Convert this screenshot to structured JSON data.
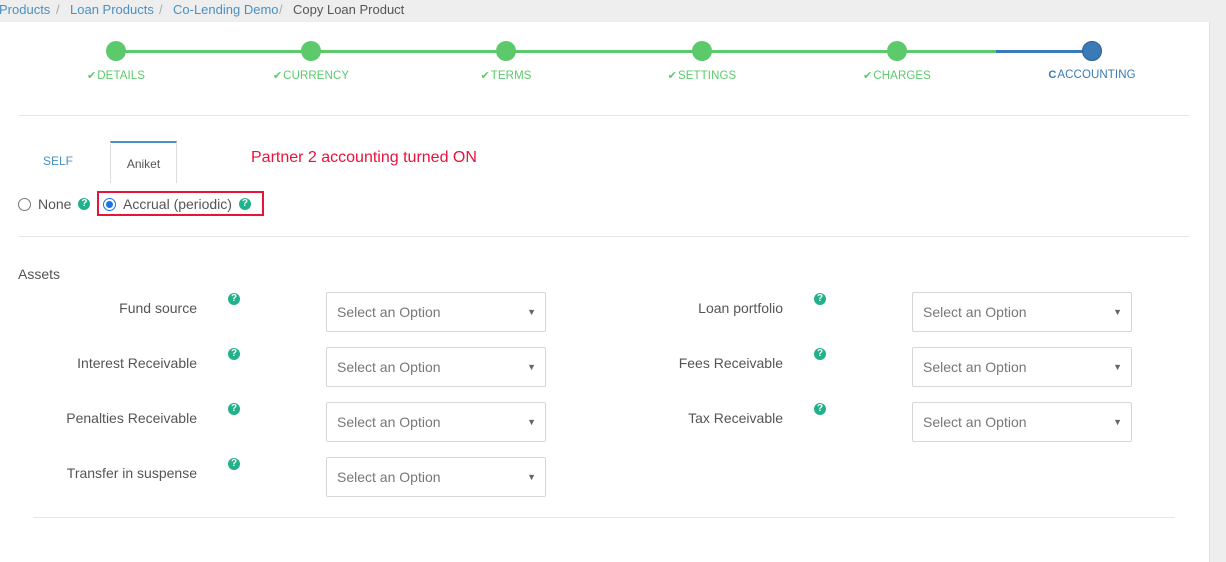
{
  "breadcrumb": {
    "items": [
      "Products",
      "Loan Products",
      "Co-Lending Demo",
      "Copy Loan Product"
    ],
    "separator": "/"
  },
  "stepper": {
    "steps": [
      {
        "label": "DETAILS",
        "icon": "check-icon",
        "status": "done"
      },
      {
        "label": "CURRENCY",
        "icon": "check-icon",
        "status": "done"
      },
      {
        "label": "TERMS",
        "icon": "check-icon",
        "status": "done"
      },
      {
        "label": "SETTINGS",
        "icon": "check-icon",
        "status": "done"
      },
      {
        "label": "CHARGES",
        "icon": "check-icon",
        "status": "done"
      },
      {
        "label": "ACCOUNTING",
        "icon": "refresh-icon",
        "status": "active"
      }
    ],
    "check_glyph": "✔",
    "refresh_glyph": "C",
    "colors": {
      "done": "#5cc96b",
      "active": "#3a7ab6"
    }
  },
  "tabs": {
    "items": [
      "SELF",
      "Aniket"
    ],
    "active": "Aniket"
  },
  "annotation": "Partner 2 accounting turned ON",
  "accounting_rule": {
    "options": [
      "None",
      "Accrual (periodic)"
    ],
    "selected": "Accrual (periodic)"
  },
  "help_glyph": "?",
  "assets": {
    "title": "Assets",
    "placeholder": "Select an Option",
    "caret": "▼",
    "left_fields": [
      "Fund source",
      "Interest Receivable",
      "Penalties Receivable",
      "Transfer in suspense"
    ],
    "right_fields": [
      "Loan portfolio",
      "Fees Receivable",
      "Tax Receivable"
    ]
  },
  "colors": {
    "link": "#4a90c2",
    "help": "#21b18b",
    "annotation": "#e8123c",
    "radio_checked": "#1a73e8"
  }
}
